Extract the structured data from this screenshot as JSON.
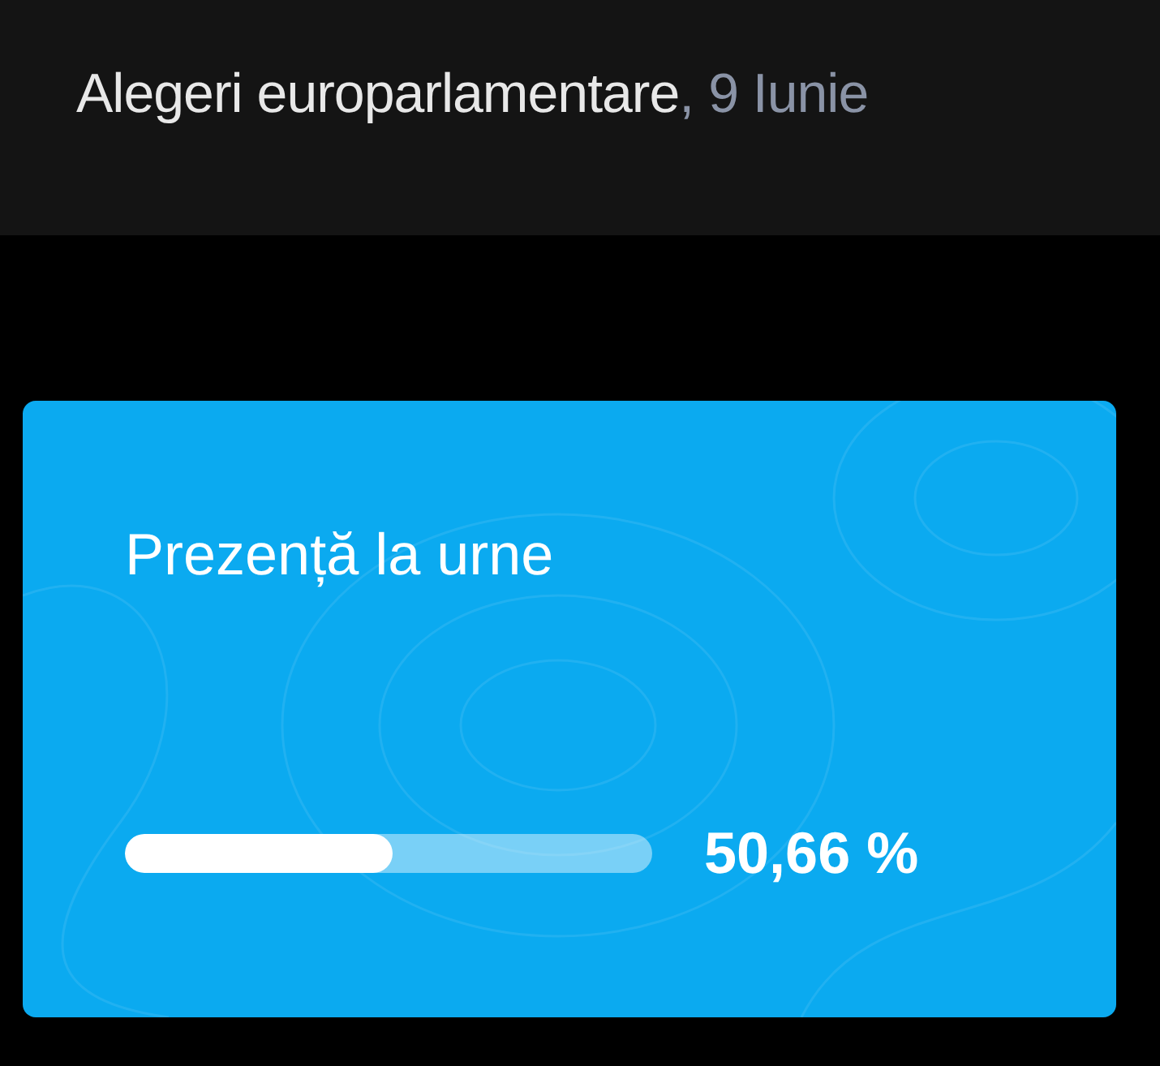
{
  "header": {
    "title": "Alegeri europarlamentare",
    "date": ", 9 Iunie"
  },
  "turnout_card": {
    "title": "Prezență la urne",
    "level": 0.5066,
    "value": "50,66 %"
  }
}
